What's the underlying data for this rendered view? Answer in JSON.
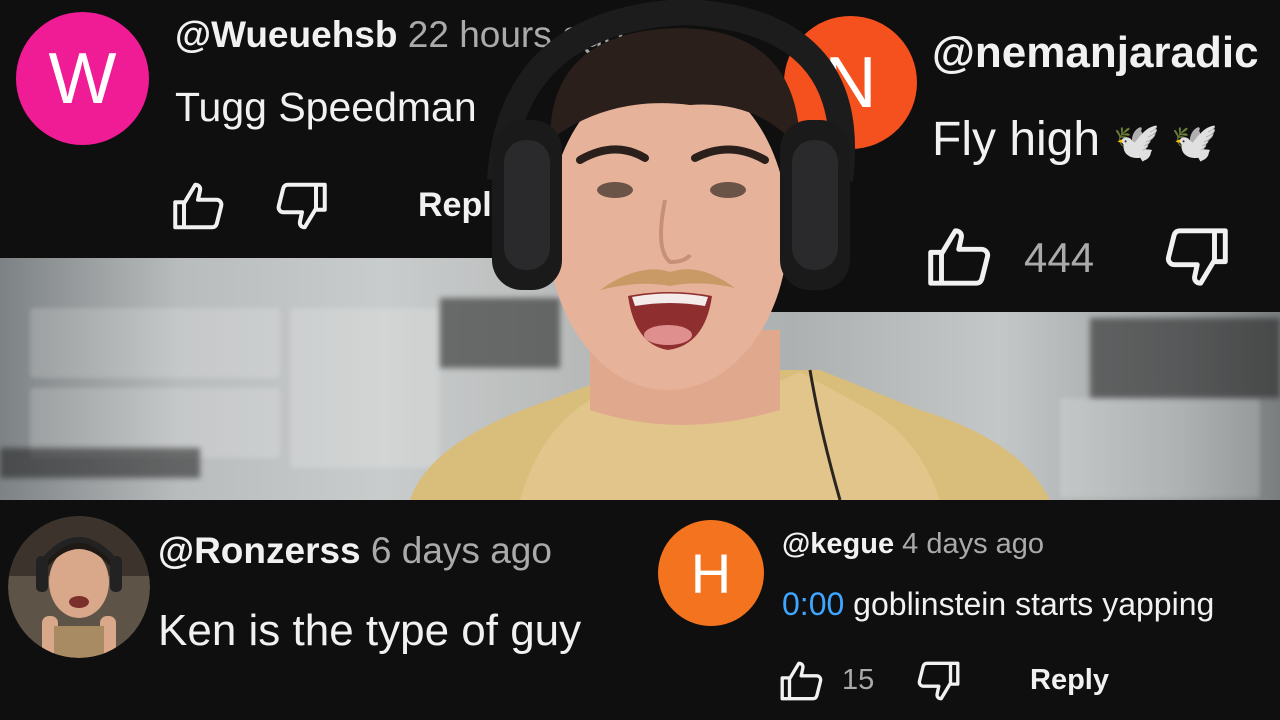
{
  "comments": [
    {
      "avatar_letter": "W",
      "avatar_color": "#ef1c96",
      "username": "@Wueuehsb",
      "time": "22 hours ago",
      "text": "Tugg Speedman",
      "reply_label": "Reply",
      "icons": [
        "like-icon",
        "dislike-icon"
      ]
    },
    {
      "avatar_letter": "N",
      "avatar_color": "#f4511e",
      "username": "@nemanjaradic",
      "text": "Fly high",
      "emoji": "🕊️ 🕊️",
      "like_count": "444",
      "icons": [
        "like-icon",
        "dislike-icon"
      ]
    },
    {
      "username": "@Ronzerss",
      "time": "6 days ago",
      "text": "Ken is the type of guy",
      "avatar": "photo-avatar"
    },
    {
      "avatar_letter": "H",
      "avatar_color": "#f4731e",
      "username": "@kegue",
      "time": "4 days ago",
      "timestamp": "0:00",
      "text": "goblinstein starts yapping",
      "like_count": "15",
      "reply_label": "Reply",
      "icons": [
        "like-icon",
        "dislike-icon"
      ]
    }
  ],
  "colors": {
    "background": "#0f0f0f",
    "text": "#f1f1f1",
    "secondary_text": "#aaaaaa",
    "timestamp_link": "#3ea6ff"
  }
}
